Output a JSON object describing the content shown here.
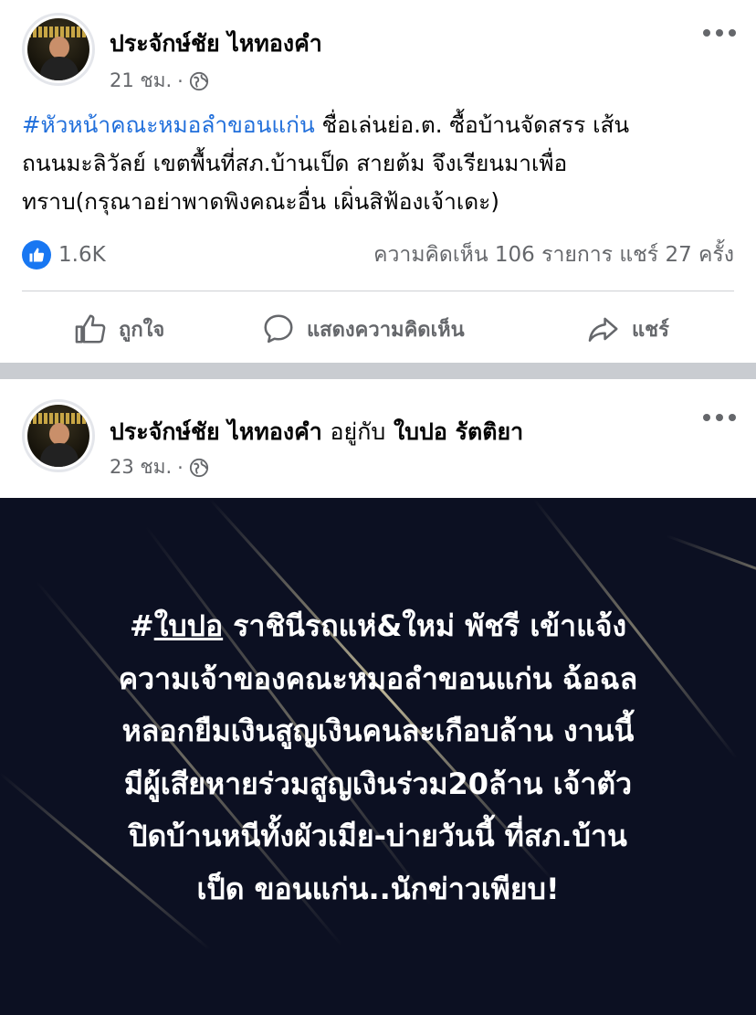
{
  "post1": {
    "author": "ประจักษ์ชัย ไหทองคำ",
    "time": "21 ชม.",
    "dot": "·",
    "hashtag": "#หัวหน้าคณะหมอลำขอนแก่น",
    "text_line1_rest": " ชื่อเล่นย่อ.ต. ซื้อบ้านจัดสรร เส้น",
    "text_line2": "ถนนมะลิวัลย์ เขตพื้นที่สภ.บ้านเป็ด สายต้ม จึงเรียนมาเพื่อ",
    "text_line3": "ทราบ(กรุณาอย่าพาดพิงคณะอื่น เผิ่นสิฟ้องเจ้าเดะ)",
    "like_count": "1.6K",
    "comments_shares": "ความคิดเห็น 106 รายการ  แชร์ 27 ครั้ง",
    "actions": {
      "like": "ถูกใจ",
      "comment": "แสดงความคิดเห็น",
      "share": "แชร์"
    }
  },
  "post2": {
    "author": "ประจักษ์ชัย ไหทองคำ",
    "with_label": "อยู่กับ",
    "tagged": "ใบปอ รัตติยา",
    "time": "23 ชม.",
    "dot": "·",
    "image_text": {
      "hash": "#",
      "tag": "ใบปอ",
      "line1_rest": " ราชินีรถแห่&ใหม่ พัชรี เข้าแจ้ง",
      "line2": "ความเจ้าของคณะหมอลำขอนแก่น ฉ้อฉล",
      "line3": "หลอกยืมเงินสูญเงินคนละเกือบล้าน งานนี้",
      "line4": "มีผู้เสียหายร่วมสูญเงินร่วม20ล้าน เจ้าตัว",
      "line5": "ปิดบ้านหนีทั้งผัวเมีย-บ่ายวันนี้ ที่สภ.บ้าน",
      "line6": "เป็ด ขอนแก่น..นักข่าวเพียบ!"
    }
  },
  "colors": {
    "hashtag": "#216fdb",
    "secondary_text": "#65676b",
    "like_blue": "#1877f2",
    "separator": "#c9ccd1",
    "image_bg": "#0c1022"
  },
  "icons": [
    "globe-icon",
    "more-options-icon",
    "like-badge-icon",
    "thumbs-up-icon",
    "comment-icon",
    "share-icon"
  ]
}
